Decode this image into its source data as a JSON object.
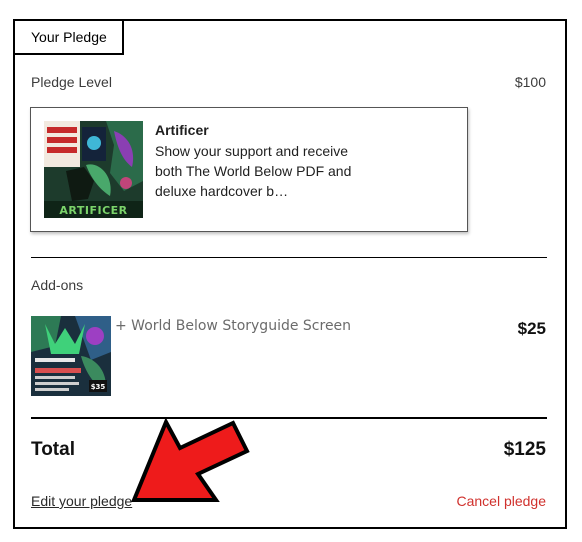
{
  "tab": {
    "label": "Your Pledge"
  },
  "pledge": {
    "level_label": "Pledge Level",
    "amount": "$100",
    "reward": {
      "title": "Artificer",
      "description": "Show your support and receive both The World Below PDF and deluxe hardcover b…",
      "thumbnail_text": "ARTIFICER"
    }
  },
  "addons": {
    "section_label": "Add-ons",
    "items": [
      {
        "name": "+ World Below Storyguide Screen",
        "price": "$25",
        "thumbnail_price_tag": "$35"
      }
    ]
  },
  "total": {
    "label": "Total",
    "amount": "$125"
  },
  "actions": {
    "edit_label": "Edit your pledge",
    "cancel_label": "Cancel pledge"
  },
  "colors": {
    "arrow": "#ee1b1b",
    "cancel": "#d0312d"
  }
}
